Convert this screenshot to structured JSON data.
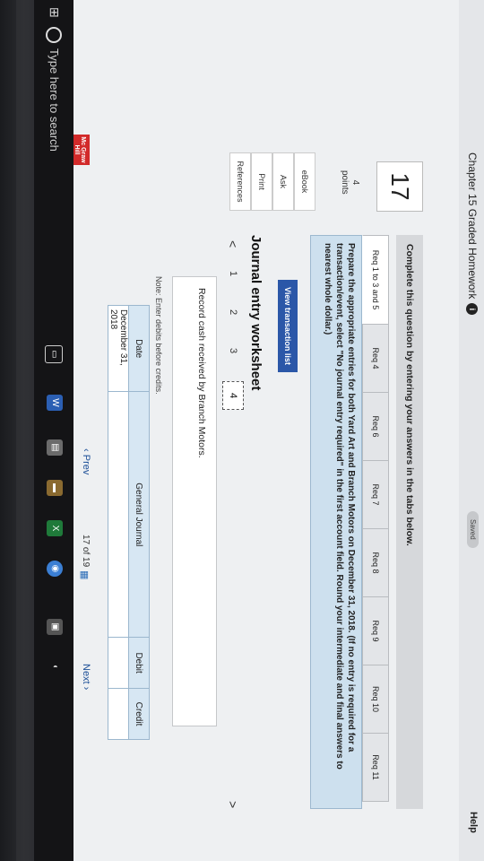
{
  "header": {
    "title": "Chapter 15 Graded Homework",
    "info_icon": "i",
    "saved": "Saved",
    "help": "Help"
  },
  "question": {
    "number": "17",
    "points_value": "4",
    "points_label": "points",
    "side_buttons": [
      "eBook",
      "Ask",
      "Print",
      "References"
    ]
  },
  "instruction": "Complete this question by entering your answers in the tabs below.",
  "tabs": [
    {
      "label": "Req 1 to 3 and 5",
      "active": true
    },
    {
      "label": "Req 4",
      "active": false
    },
    {
      "label": "Req 6",
      "active": false
    },
    {
      "label": "Req 7",
      "active": false
    },
    {
      "label": "Req 8",
      "active": false
    },
    {
      "label": "Req 9",
      "active": false
    },
    {
      "label": "Req 10",
      "active": false
    },
    {
      "label": "Req 11",
      "active": false
    }
  ],
  "task_text": "Prepare the appropriate entries for both Yard Art and Branch Motors on December 31, 2018. (If no entry is required for a transaction/event, select \"No journal entry required\" in the first account field. Round your intermediate and final answers to nearest whole dollar.)",
  "view_transaction_list": "View transaction list",
  "worksheet": {
    "title": "Journal entry worksheet",
    "prev_arrow": "<",
    "next_arrow": ">",
    "steps": [
      "1",
      "2",
      "3",
      "4"
    ],
    "record_text": "Record cash received by Branch Motors.",
    "note": "Note: Enter debits before credits."
  },
  "journal_table": {
    "headers": [
      "Date",
      "General Journal",
      "Debit",
      "Credit"
    ],
    "rows": [
      [
        "December 31, 2018",
        "",
        "",
        ""
      ]
    ]
  },
  "footer": {
    "prev": "Prev",
    "page_current": "17",
    "page_of": "of",
    "page_total": "19",
    "next": "Next"
  },
  "logo": {
    "text": "Mc Graw Hill Education"
  },
  "taskbar": {
    "search_placeholder": "Type here to search"
  }
}
